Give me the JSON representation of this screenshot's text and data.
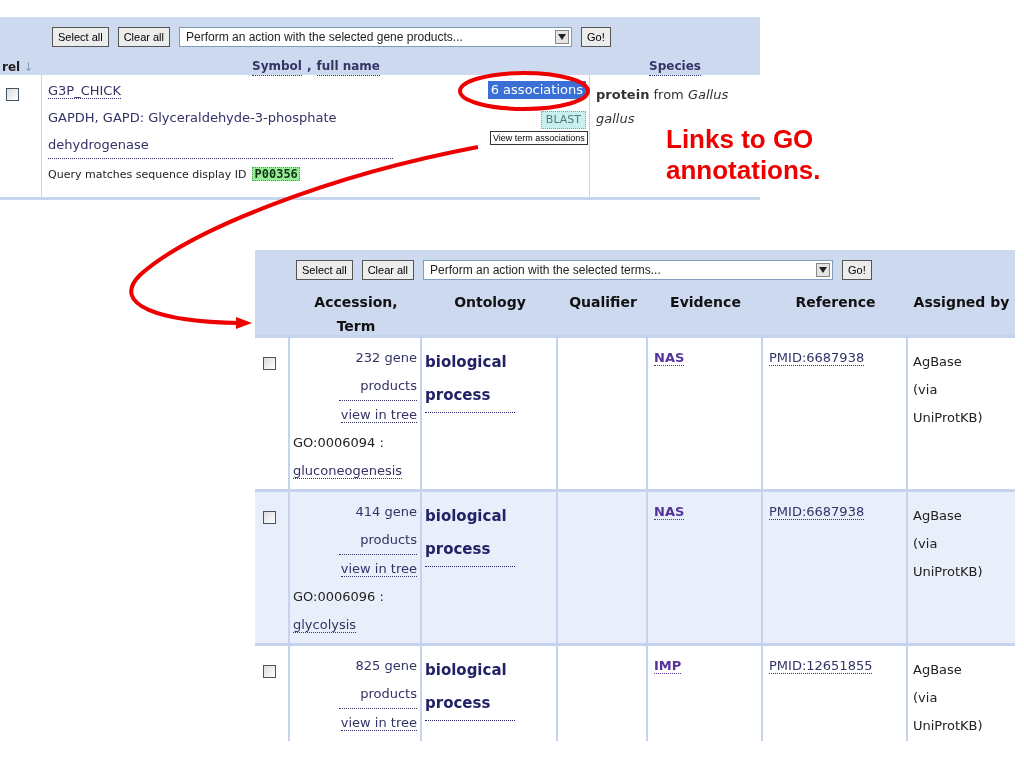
{
  "gene_panel": {
    "toolbar": {
      "select_all": "Select all",
      "clear_all": "Clear all",
      "action": "Perform an action with the selected gene products...",
      "go": "Go!"
    },
    "header": {
      "rel": "rel",
      "sort_arrow": "↓",
      "symbol": "Symbol",
      "separator": ",",
      "full_name": "full name",
      "species": "Species"
    },
    "rows": [
      {
        "checked": false,
        "symbol": "G3P_CHICK",
        "full_name": "GAPDH, GAPD: Glyceraldehyde-3-phosphate dehydrogenase",
        "associations": "6 associations",
        "blast": "BLAST",
        "species": "**protein** from *Gallus gallus*",
        "query_text": "Query matches sequence display ID",
        "display_id": "P00356"
      }
    ],
    "tooltip": "View term associations"
  },
  "callout": "Links to GO annotations.",
  "terms_panel": {
    "toolbar": {
      "select_all": "Select all",
      "clear_all": "Clear all",
      "action": "Perform an action with the selected terms...",
      "go": "Go!"
    },
    "columns": [
      "Accession, Term",
      "Ontology",
      "Qualifier",
      "Evidence",
      "Reference",
      "Assigned by"
    ],
    "rows": [
      {
        "checked": false,
        "gene_products": "232 gene products",
        "tree_link": "view in tree",
        "accession": "GO:0006094 :",
        "term": "gluconeogenesis",
        "ontology": "biological process",
        "evidence": "NAS",
        "reference": "PMID:6687938",
        "assigned_by": "AgBase (via UniProtKB)"
      },
      {
        "checked": false,
        "gene_products": "414 gene products",
        "tree_link": "view in tree",
        "accession": "GO:0006096 :",
        "term": "glycolysis",
        "ontology": "biological process",
        "evidence": "NAS",
        "reference": "PMID:6687938",
        "assigned_by": "AgBase (via UniProtKB)"
      },
      {
        "checked": false,
        "gene_products": "825 gene products",
        "tree_link": "view in tree",
        "ontology": "biological process",
        "evidence": "IMP",
        "reference": "PMID:12651855",
        "assigned_by": "AgBase (via UniProtKB)"
      }
    ]
  }
}
